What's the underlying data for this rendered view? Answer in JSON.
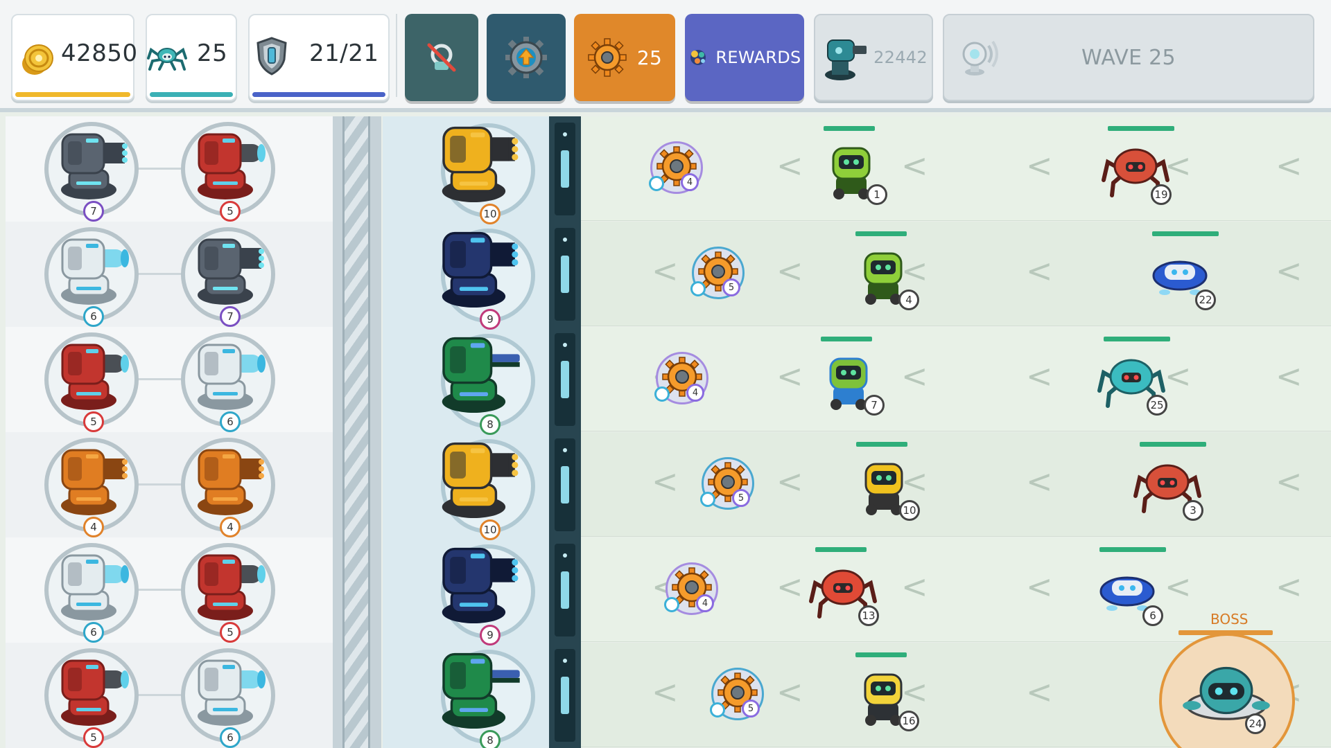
{
  "stats": {
    "coins": "42850",
    "spiders": "25",
    "shield": "21/21"
  },
  "buttons": {
    "gear_count": "25",
    "rewards_label": "REWARDS",
    "turret_score": "22442",
    "wave_label": "WAVE 25"
  },
  "colors": {
    "coin_bar": "#f0b82b",
    "spider_bar": "#3bb0b5",
    "shield_bar": "#4a63c8",
    "btn_dark_teal": "#3d6468",
    "btn_navy": "#2f5a6e",
    "btn_orange": "#e0882a",
    "btn_rewards": "#5b66c3",
    "hp_green": "#2fae7a",
    "boss_orange": "#e3963a"
  },
  "turret_grid": [
    [
      {
        "type": "gatling-gray",
        "level": "7"
      },
      {
        "type": "cannon-red",
        "level": "5"
      }
    ],
    [
      {
        "type": "plasma-white",
        "level": "6"
      },
      {
        "type": "gatling-gray",
        "level": "7"
      }
    ],
    [
      {
        "type": "cannon-red",
        "level": "5"
      },
      {
        "type": "plasma-white",
        "level": "6"
      }
    ],
    [
      {
        "type": "gatling-orange",
        "level": "4"
      },
      {
        "type": "gatling-orange",
        "level": "4"
      }
    ],
    [
      {
        "type": "plasma-white",
        "level": "6"
      },
      {
        "type": "cannon-red",
        "level": "5"
      }
    ],
    [
      {
        "type": "cannon-red",
        "level": "5"
      },
      {
        "type": "plasma-white",
        "level": "6"
      }
    ]
  ],
  "defense_turrets": [
    {
      "type": "gatling-gold",
      "level": "10"
    },
    {
      "type": "gatling-navy",
      "level": "9"
    },
    {
      "type": "railgun-green",
      "level": "8"
    },
    {
      "type": "gatling-gold",
      "level": "10"
    },
    {
      "type": "gatling-navy",
      "level": "9"
    },
    {
      "type": "railgun-green",
      "level": "8"
    }
  ],
  "gear_drops": [
    "4",
    "5",
    "4",
    "5",
    "4",
    "5"
  ],
  "enemies": [
    [
      "1",
      "19"
    ],
    [
      "4",
      "22"
    ],
    [
      "7",
      "25"
    ],
    [
      "10",
      "3"
    ],
    [
      "13",
      "6"
    ],
    [
      "16",
      "24"
    ]
  ],
  "boss": {
    "label": "BOSS",
    "level": "24"
  }
}
